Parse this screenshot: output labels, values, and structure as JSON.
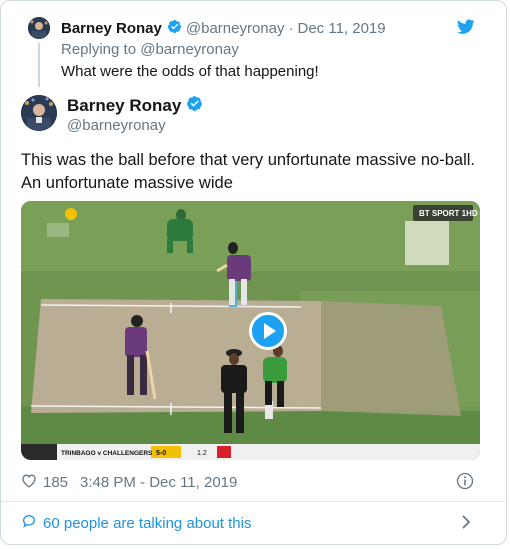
{
  "parent_tweet": {
    "author_name": "Barney Ronay",
    "handle": "@barneyronay",
    "separator": "·",
    "date": "Dec 11, 2019",
    "replying_to": "Replying to @barneyronay",
    "text": "What were the odds of that happening!"
  },
  "main_tweet": {
    "author_name": "Barney Ronay",
    "handle": "@barneyronay",
    "text": "This was the ball before that very unfortunate massive no-ball. An unfortunate massive wide"
  },
  "media": {
    "type": "video",
    "broadcaster_logo": "BT SPORT 1HD",
    "scoreboard": {
      "teams": "TRINBAGO v CHALLENGERS",
      "score": "5-0",
      "overs": "1.2"
    }
  },
  "stats": {
    "likes": "185",
    "time": "3:48 PM - Dec 11, 2019"
  },
  "conversation": {
    "label": "60 people are talking about this"
  },
  "colors": {
    "accent": "#1da1f2",
    "link": "#1b95e0",
    "muted": "#657786",
    "text": "#14171a"
  },
  "icons": {
    "verified": "verified-badge-icon",
    "bird": "twitter-bird-icon",
    "heart": "heart-icon",
    "info": "info-icon",
    "bubble": "comment-bubble-icon",
    "chevron": "chevron-right-icon",
    "play": "play-icon"
  }
}
